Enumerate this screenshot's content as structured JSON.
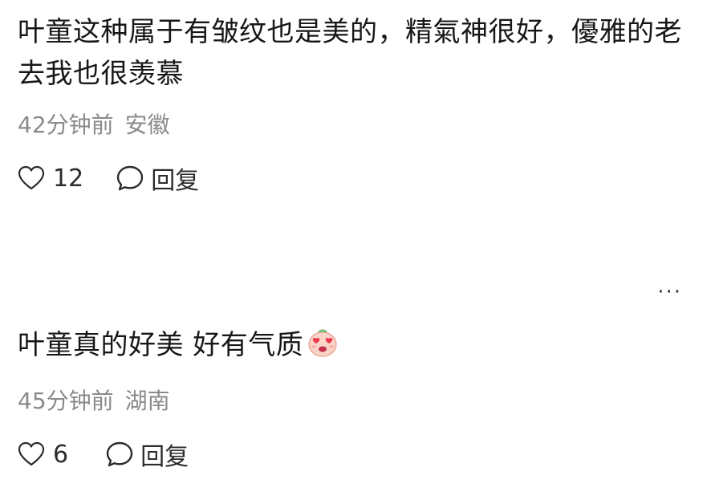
{
  "comments": [
    {
      "text": "叶童这种属于有皱纹也是美的，精氣神很好，優雅的老去我也很羡慕",
      "time": "42分钟前",
      "location": "安徽",
      "likes": "12",
      "reply_label": "回复"
    },
    {
      "text": "叶童真的好美 好有气质",
      "emoji": "heart-eyes-emoji",
      "time": "45分钟前",
      "location": "湖南",
      "likes": "6",
      "reply_label": "回复"
    }
  ],
  "more_label": "···",
  "colors": {
    "text": "#171717",
    "meta": "#8a8a8a",
    "icon": "#2b2b2b"
  }
}
